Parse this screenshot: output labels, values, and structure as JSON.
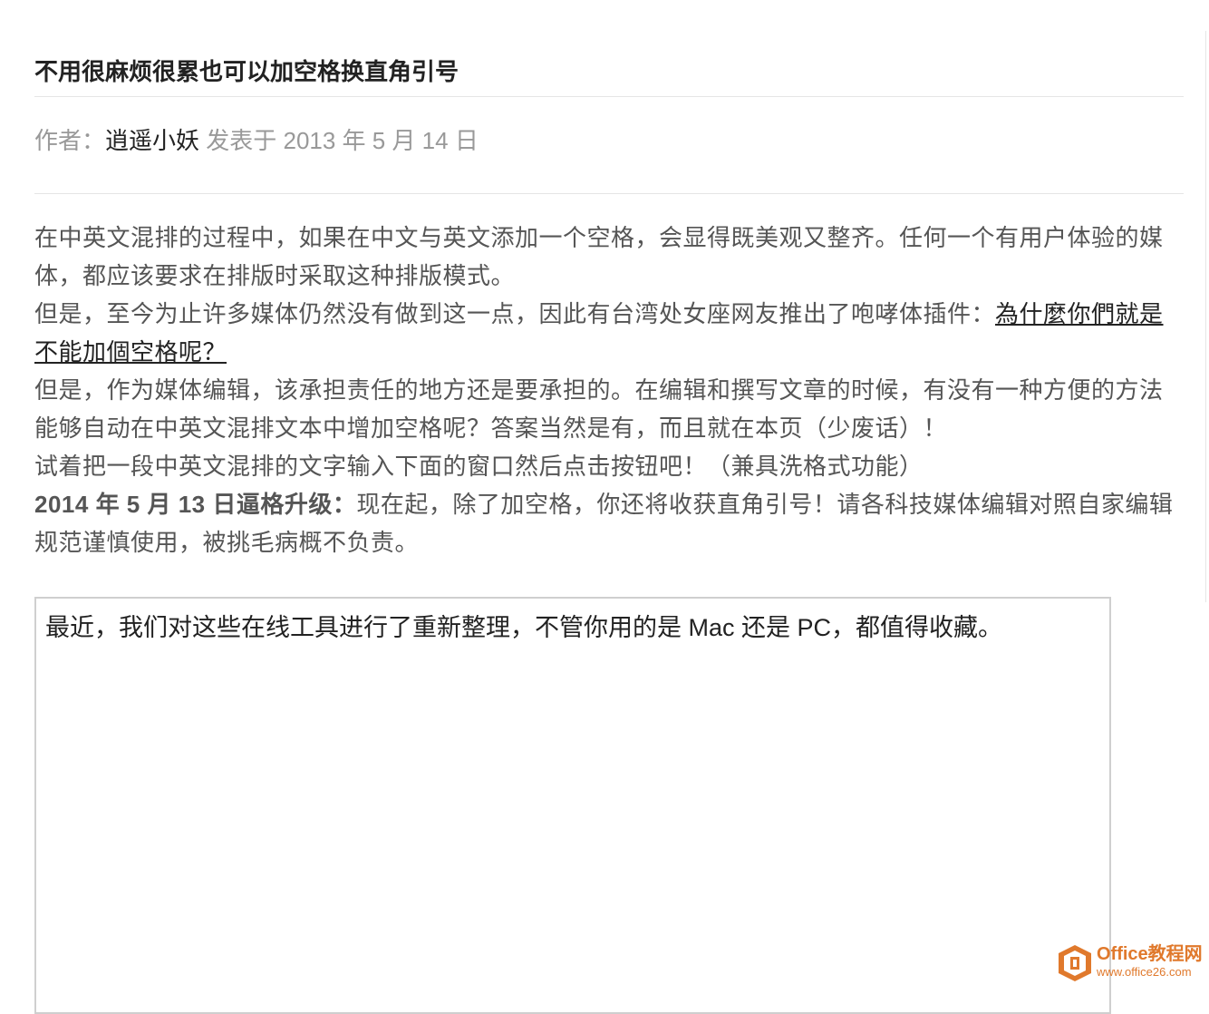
{
  "article": {
    "title": "不用很麻烦很累也可以加空格换直角引号",
    "meta": {
      "author_label": "作者：",
      "author_name": "逍遥小妖",
      "published": " 发表于 2013 年 5 月 14 日"
    },
    "paragraphs": {
      "p1": "在中英文混排的过程中，如果在中文与英文添加一个空格，会显得既美观又整齐。任何一个有用户体验的媒体，都应该要求在排版时采取这种排版模式。",
      "p2_text": "但是，至今为止许多媒体仍然没有做到这一点，因此有台湾处女座网友推出了咆哮体插件：",
      "p2_link": "為什麼你們就是不能加個空格呢？",
      "p3": "但是，作为媒体编辑，该承担责任的地方还是要承担的。在编辑和撰写文章的时候，有没有一种方便的方法能够自动在中英文混排文本中增加空格呢？答案当然是有，而且就在本页（少废话）！",
      "p4": "试着把一段中英文混排的文字输入下面的窗口然后点击按钮吧！（兼具洗格式功能）",
      "p5_bold": "2014 年 5 月 13 日逼格升级：",
      "p5_text": "现在起，除了加空格，你还将收获直角引号！请各科技媒体编辑对照自家编辑规范谨慎使用，被挑毛病概不负责。"
    }
  },
  "editor": {
    "value": "最近，我们对这些在线工具进行了重新整理，不管你用的是 Mac 还是 PC，都值得收藏。"
  },
  "watermark": {
    "title": "Office教程网",
    "url": "www.office26.com",
    "icon": "office-logo-icon"
  },
  "colors": {
    "title": "#222222",
    "meta": "#999999",
    "body_text": "#555555",
    "divider": "#e5e5e5",
    "editor_border": "#cfcfcf",
    "watermark": "#e0792c"
  }
}
